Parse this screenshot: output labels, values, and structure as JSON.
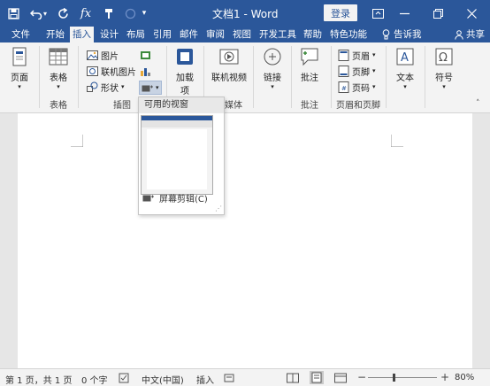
{
  "titlebar": {
    "title": "文档1 - Word",
    "login_label": "登录"
  },
  "tabs": [
    {
      "label": "文件"
    },
    {
      "label": "开始"
    },
    {
      "label": "插入"
    },
    {
      "label": "设计"
    },
    {
      "label": "布局"
    },
    {
      "label": "引用"
    },
    {
      "label": "邮件"
    },
    {
      "label": "审阅"
    },
    {
      "label": "视图"
    },
    {
      "label": "开发工具"
    },
    {
      "label": "帮助"
    },
    {
      "label": "特色功能"
    }
  ],
  "tell_me": "告诉我",
  "share": "共享",
  "ribbon": {
    "page": "页面",
    "table": "表格",
    "picture": "图片",
    "online_picture": "联机图片",
    "shapes": "形状",
    "addins": "加载",
    "addins2": "项",
    "online_video": "联机视频",
    "link": "链接",
    "comment": "批注",
    "header": "页眉",
    "footer": "页脚",
    "page_number": "页码",
    "text": "文本",
    "symbol": "符号",
    "groups": {
      "table": "表格",
      "illustrations": "插图",
      "media": "媒体",
      "comment": "批注",
      "header_footer": "页眉和页脚"
    }
  },
  "dropdown": {
    "header": "可用的视窗",
    "screen_clipping": "屏幕剪辑(C)"
  },
  "statusbar": {
    "page_info": "第 1 页，共 1 页",
    "word_count": "0 个字",
    "language": "中文(中国)",
    "insert_mode": "插入",
    "zoom": "80%"
  },
  "colors": {
    "brand": "#2b579a",
    "ribbon_bg": "#f3f3f3"
  }
}
